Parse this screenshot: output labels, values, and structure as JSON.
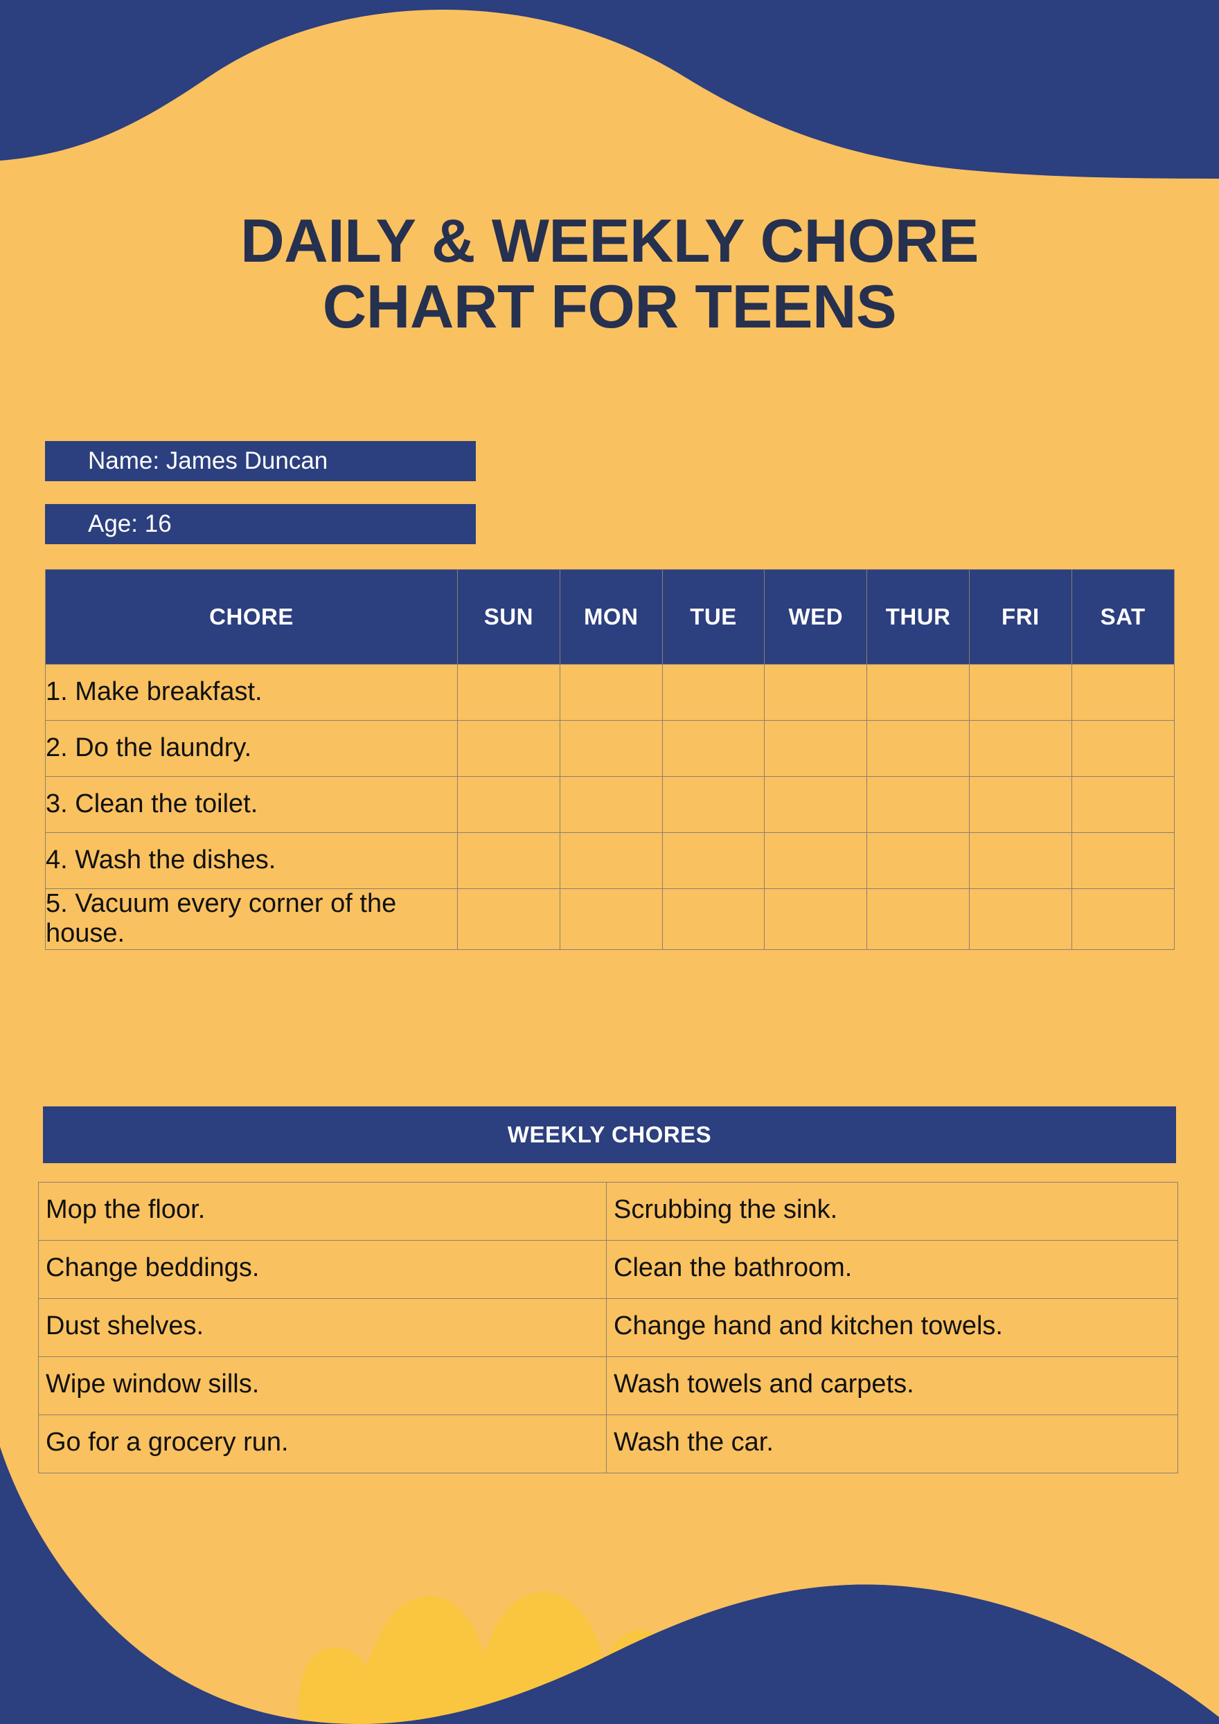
{
  "theme": {
    "background": "#F9C160",
    "navy": "#2C3F7E",
    "title_navy": "#26304F",
    "accent_yellow": "#FBC63F",
    "grid_line": "#8A8070",
    "text_dark": "#111111",
    "text_light": "#FFFFFF"
  },
  "title": {
    "line1": "DAILY & WEEKLY CHORE",
    "line2": "CHART FOR TEENS"
  },
  "fields": {
    "name": "Name: James Duncan",
    "age": "Age: 16"
  },
  "daily_table": {
    "columns": [
      "CHORE",
      "SUN",
      "MON",
      "TUE",
      "WED",
      "THUR",
      "FRI",
      "SAT"
    ],
    "rows": [
      {
        "chore": "1. Make breakfast.",
        "sun": "",
        "mon": "",
        "tue": "",
        "wed": "",
        "thur": "",
        "fri": "",
        "sat": ""
      },
      {
        "chore": "2. Do the laundry.",
        "sun": "",
        "mon": "",
        "tue": "",
        "wed": "",
        "thur": "",
        "fri": "",
        "sat": ""
      },
      {
        "chore": "3. Clean the toilet.",
        "sun": "",
        "mon": "",
        "tue": "",
        "wed": "",
        "thur": "",
        "fri": "",
        "sat": ""
      },
      {
        "chore": "4. Wash the dishes.",
        "sun": "",
        "mon": "",
        "tue": "",
        "wed": "",
        "thur": "",
        "fri": "",
        "sat": ""
      },
      {
        "chore": "5. Vacuum every corner of the house.",
        "sun": "",
        "mon": "",
        "tue": "",
        "wed": "",
        "thur": "",
        "fri": "",
        "sat": ""
      }
    ]
  },
  "weekly": {
    "banner": "WEEKLY CHORES",
    "rows": [
      {
        "left": "Mop the floor.",
        "right": "Scrubbing the sink."
      },
      {
        "left": "Change beddings.",
        "right": "Clean the bathroom."
      },
      {
        "left": "Dust shelves.",
        "right": "Change hand and kitchen towels."
      },
      {
        "left": "Wipe window sills.",
        "right": "Wash towels and carpets."
      },
      {
        "left": "Go for a grocery run.",
        "right": "Wash the car."
      }
    ]
  }
}
